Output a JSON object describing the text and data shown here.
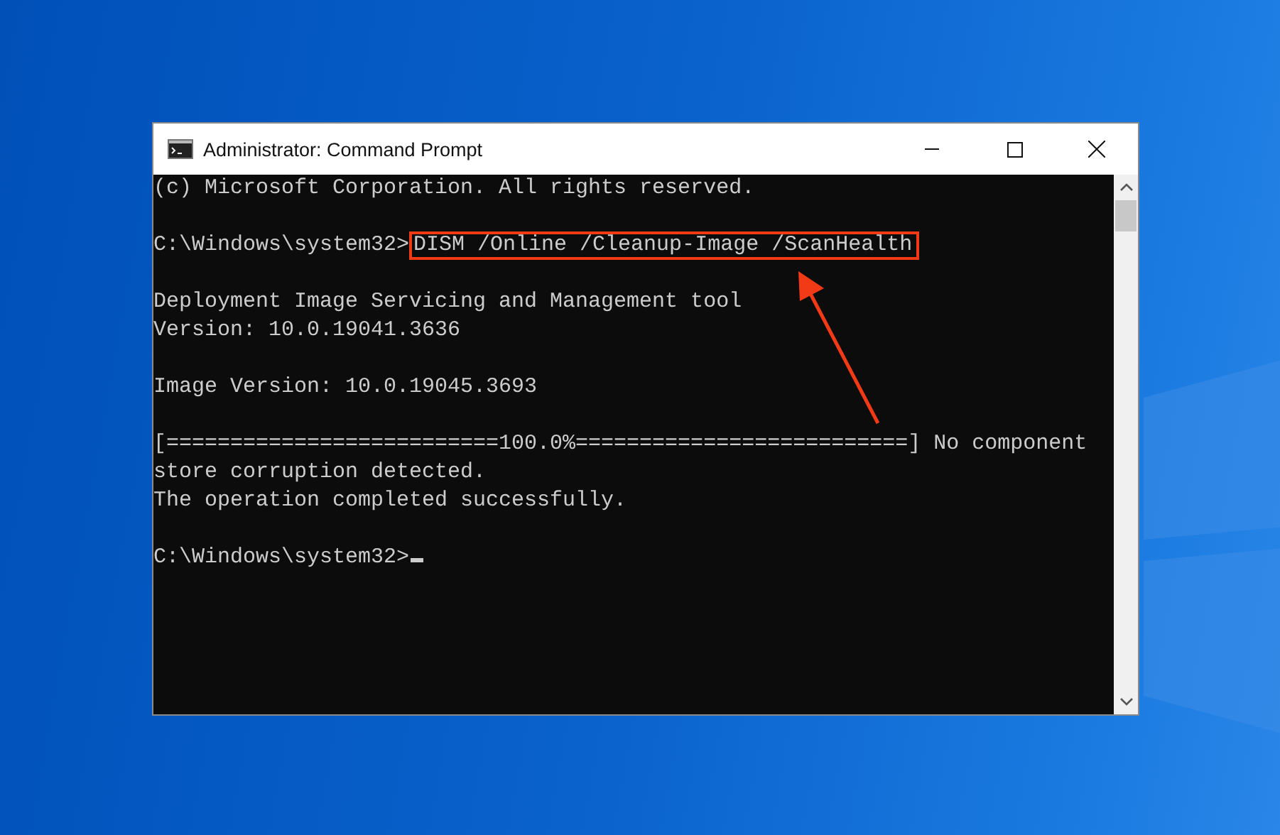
{
  "window": {
    "title": "Administrator: Command Prompt"
  },
  "console": {
    "lines": [
      {
        "kind": "text",
        "text": "(c) Microsoft Corporation. All rights reserved."
      },
      {
        "kind": "blank"
      },
      {
        "kind": "command",
        "prompt": "C:\\Windows\\system32>",
        "command": "DISM /Online /Cleanup-Image /ScanHealth",
        "highlighted": true
      },
      {
        "kind": "blank"
      },
      {
        "kind": "text",
        "text": "Deployment Image Servicing and Management tool"
      },
      {
        "kind": "text",
        "text": "Version: 10.0.19041.3636"
      },
      {
        "kind": "blank"
      },
      {
        "kind": "text",
        "text": "Image Version: 10.0.19045.3693"
      },
      {
        "kind": "blank"
      },
      {
        "kind": "text",
        "text": "[==========================100.0%==========================] No component"
      },
      {
        "kind": "text",
        "text": "store corruption detected."
      },
      {
        "kind": "text",
        "text": "The operation completed successfully."
      },
      {
        "kind": "blank"
      },
      {
        "kind": "command",
        "prompt": "C:\\Windows\\system32>",
        "cursor": true
      }
    ]
  }
}
